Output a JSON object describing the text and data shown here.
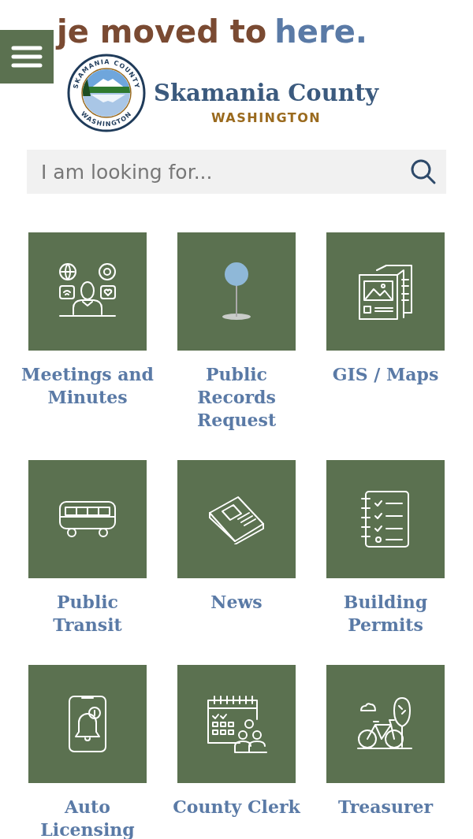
{
  "notice": {
    "text": "je moved to",
    "link": "here."
  },
  "site": {
    "title": "Skamania County",
    "subtitle": "WASHINGTON",
    "seal_top": "SKAMANIA COUNTY",
    "seal_bottom": "WASHINGTON"
  },
  "search": {
    "placeholder": "I am looking for..."
  },
  "tiles": [
    {
      "label": "Meetings and Minutes"
    },
    {
      "label": "Public Records Request"
    },
    {
      "label": "GIS / Maps"
    },
    {
      "label": "Public Transit"
    },
    {
      "label": "News"
    },
    {
      "label": "Building Permits"
    },
    {
      "label": "Auto Licensing"
    },
    {
      "label": "County Clerk"
    },
    {
      "label": "Treasurer"
    }
  ]
}
